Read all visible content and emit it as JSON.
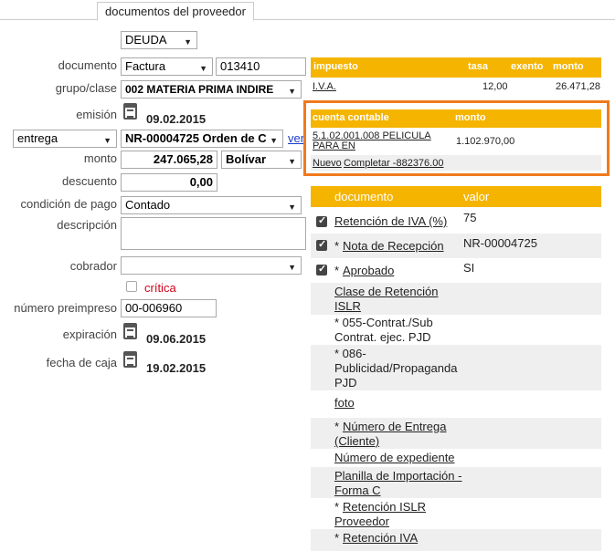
{
  "tab": {
    "label": "documentos del proveedor"
  },
  "form": {
    "type_select": "DEUDA",
    "documento_label": "documento",
    "documento_type": "Factura",
    "documento_number": "013410",
    "grupo_label": "grupo/clase",
    "grupo_value": "002 MATERIA PRIMA INDIRE",
    "emision_label": "emisión",
    "emision_date": "09.02.2015",
    "entrega_select": "entrega",
    "entrega_value": "NR-00004725 Orden de C",
    "ver_link": "ver",
    "monto_label": "monto",
    "monto_value": "247.065,28",
    "currency": "Bolívar",
    "descuento_label": "descuento",
    "descuento_value": "0,00",
    "condicion_label": "condición de pago",
    "condicion_value": "Contado",
    "descripcion_label": "descripción",
    "descripcion_value": "",
    "cobrador_label": "cobrador",
    "cobrador_value": "",
    "critica_label": "crítica",
    "preimpreso_label": "número preimpreso",
    "preimpreso_value": "00-006960",
    "expiracion_label": "expiración",
    "expiracion_date": "09.06.2015",
    "caja_label": "fecha de caja",
    "caja_date": "19.02.2015"
  },
  "tax_table": {
    "headers": {
      "impuesto": "impuesto",
      "tasa": "tasa",
      "exento": "exento",
      "monto": "monto"
    },
    "row": {
      "impuesto": "I.V.A.",
      "tasa": "12,00",
      "exento": "",
      "monto": "26.471,28"
    }
  },
  "account_table": {
    "headers": {
      "cuenta": "cuenta contable",
      "monto": "monto"
    },
    "row": {
      "cuenta": "5.1.02.001.008 PELICULA PARA EN",
      "monto": "1.102.970,00"
    },
    "nuevo_link": "Nuevo",
    "completar_link": "Completar -882376.00"
  },
  "doc_table": {
    "headers": {
      "documento": "documento",
      "valor": "valor"
    },
    "rows": [
      {
        "label": "Retención de IVA (%)",
        "value": "75",
        "check": true,
        "req": false
      },
      {
        "label": "Nota de Recepción",
        "value": "NR-00004725",
        "check": true,
        "req": true
      },
      {
        "label": "Aprobado",
        "value": "SI",
        "check": true,
        "req": true
      },
      {
        "label": "Clase de Retención ISLR",
        "value": ""
      },
      {
        "label": "* 055-Contrat./Sub Contrat. ejec. PJD",
        "value": ""
      },
      {
        "label": "* 086-Publicidad/Propaganda PJD",
        "value": ""
      },
      {
        "label": "foto",
        "value": ""
      },
      {
        "label": "Número de Entrega (Cliente)",
        "value": "",
        "req": true
      },
      {
        "label": "Número de expediente",
        "value": ""
      },
      {
        "label": "Planilla de Importación -Forma C",
        "value": ""
      },
      {
        "label": "Retención ISLR Proveedor",
        "value": "",
        "req": true
      },
      {
        "label": "Retención IVA",
        "value": "",
        "req": true
      }
    ]
  },
  "colors": {
    "header": "#f5b400",
    "highlight_border": "#f07a1e",
    "link": "#1a3cc8"
  }
}
